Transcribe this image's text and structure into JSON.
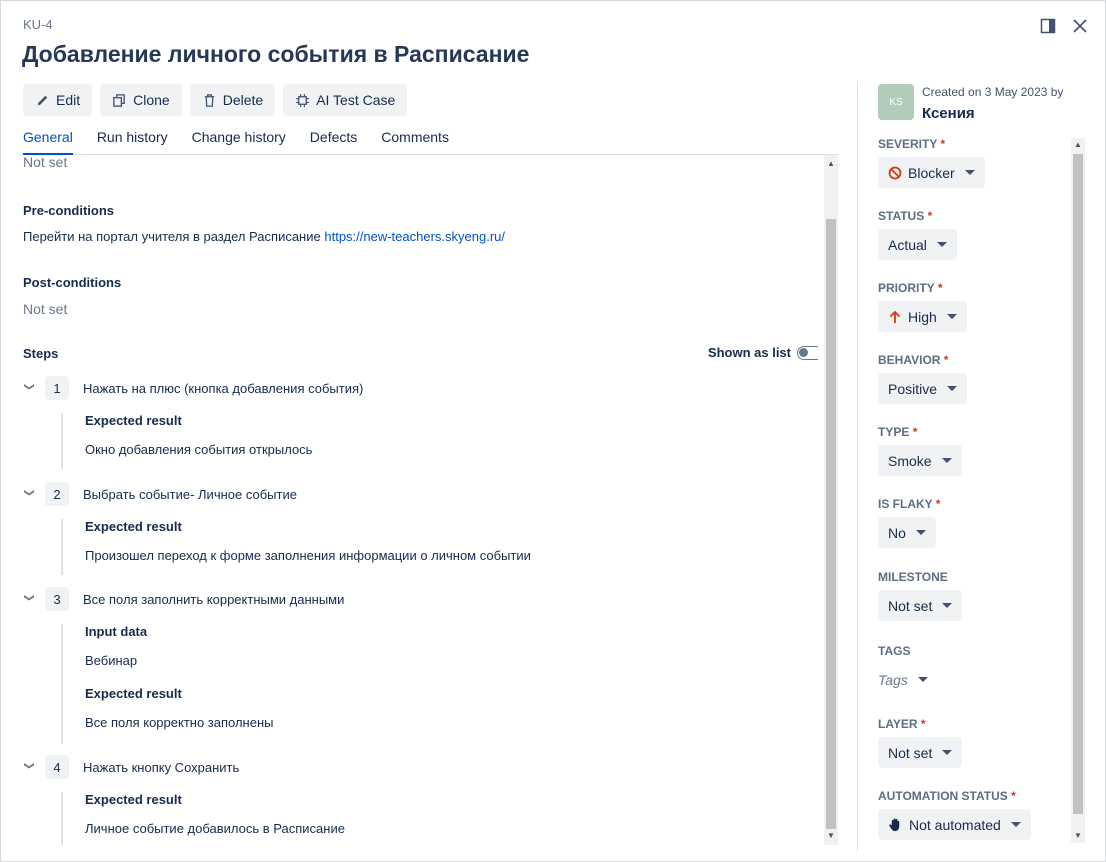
{
  "issue_key": "KU-4",
  "title": "Добавление личного события в Расписание",
  "toolbar": {
    "edit": "Edit",
    "clone": "Clone",
    "delete": "Delete",
    "ai": "AI Test Case"
  },
  "tabs": [
    "General",
    "Run history",
    "Change history",
    "Defects",
    "Comments"
  ],
  "content": {
    "top_value": "Not set",
    "preconditions_label": "Pre-conditions",
    "preconditions_text": "Перейти на портал учителя в раздел Расписание",
    "preconditions_link": "https://new-teachers.skyeng.ru/",
    "postconditions_label": "Post-conditions",
    "postconditions_value": "Not set",
    "steps_label": "Steps",
    "shown_as_list": "Shown as list",
    "steps": [
      {
        "num": "1",
        "text": "Нажать на плюс (кнопка добавления события)",
        "expected_label": "Expected result",
        "expected": "Окно добавления события открылось"
      },
      {
        "num": "2",
        "text": "Выбрать событие- Личное событие",
        "expected_label": "Expected result",
        "expected": "Произошел переход к форме заполнения информации о личном событии"
      },
      {
        "num": "3",
        "text": "Все поля заполнить корректными данными",
        "input_label": "Input data",
        "input": "Вебинар",
        "expected_label": "Expected result",
        "expected": "Все поля корректно заполнены"
      },
      {
        "num": "4",
        "text": "Нажать кнопку Сохранить",
        "expected_label": "Expected result",
        "expected": "Личное событие добавилось в Расписание"
      }
    ]
  },
  "sidebar": {
    "avatar_initials": "KS",
    "created": "Created on 3 May 2023 by",
    "author": "Ксения",
    "fields": {
      "severity": {
        "label": "SEVERITY",
        "value": "Blocker"
      },
      "status": {
        "label": "STATUS",
        "value": "Actual"
      },
      "priority": {
        "label": "PRIORITY",
        "value": "High"
      },
      "behavior": {
        "label": "BEHAVIOR",
        "value": "Positive"
      },
      "type": {
        "label": "TYPE",
        "value": "Smoke"
      },
      "is_flaky": {
        "label": "IS FLAKY",
        "value": "No"
      },
      "milestone": {
        "label": "MILESTONE",
        "value": "Not set"
      },
      "tags": {
        "label": "TAGS",
        "value": "Tags"
      },
      "layer": {
        "label": "LAYER",
        "value": "Not set"
      },
      "automation_status": {
        "label": "AUTOMATION STATUS",
        "value": "Not automated"
      }
    },
    "required_mark": "*"
  },
  "colors": {
    "accent": "#0052cc",
    "required": "#de350b",
    "blocker": "#de350b",
    "priority_high": "#de350b"
  }
}
